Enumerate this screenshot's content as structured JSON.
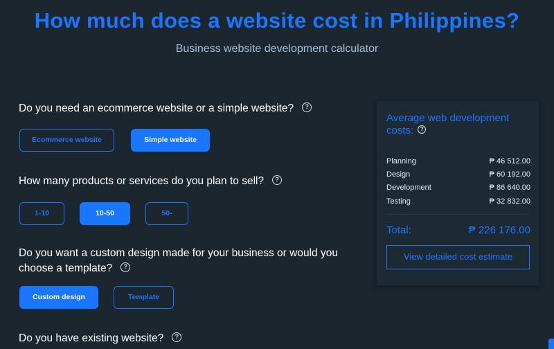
{
  "header": {
    "title": "How much does a website cost in Philippines?",
    "subtitle": "Business website development calculator"
  },
  "questions": [
    {
      "text": "Do you need an ecommerce website or a simple website?",
      "help_icon": "question-circle-icon",
      "options": [
        {
          "label": "Ecommerce website",
          "selected": false
        },
        {
          "label": "Simple website",
          "selected": true
        }
      ]
    },
    {
      "text": "How many products or services do you plan to sell?",
      "help_icon": "question-circle-icon",
      "options": [
        {
          "label": "1-10",
          "selected": false
        },
        {
          "label": "10-50",
          "selected": true
        },
        {
          "label": "50-",
          "selected": false
        }
      ]
    },
    {
      "text": "Do you want a custom design made for your business or would you choose a template?",
      "help_icon": "question-circle-icon",
      "options": [
        {
          "label": "Custom design",
          "selected": true
        },
        {
          "label": "Template",
          "selected": false
        }
      ]
    },
    {
      "text": "Do you have existing website?",
      "help_icon": "question-circle-icon",
      "options": []
    }
  ],
  "help_glyph": "?",
  "cost_panel": {
    "title": "Average web development costs:",
    "items": [
      {
        "label": "Planning",
        "value": "₱ 46 512.00"
      },
      {
        "label": "Design",
        "value": "₱ 60 192.00"
      },
      {
        "label": "Development",
        "value": "₱ 86 640.00"
      },
      {
        "label": "Testing",
        "value": "₱ 32 832.00"
      }
    ],
    "total_label": "Total:",
    "total_value": "₱ 226 176.00",
    "detail_button": "View detailed cost estimate"
  },
  "colors": {
    "accent": "#1876ff",
    "background": "#1b262f",
    "panel": "#1d2a34",
    "subtitle": "#a9bdd4"
  }
}
